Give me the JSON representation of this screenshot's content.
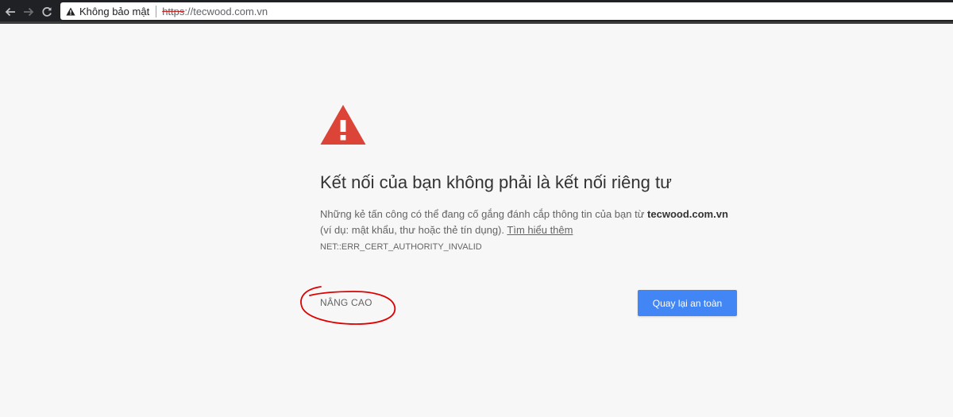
{
  "browser": {
    "security_label": "Không bảo mật",
    "url_scheme": "https",
    "url_rest": "://tecwood.com.vn",
    "icons": {
      "back": "back-arrow-icon",
      "forward": "forward-arrow-icon",
      "reload": "reload-icon",
      "security": "warning-triangle-icon"
    }
  },
  "interstitial": {
    "heading": "Kết nối của bạn không phải là kết nối riêng tư",
    "body_before_domain": "Những kẻ tấn công có thể đang cố gắng đánh cắp thông tin của bạn từ ",
    "domain": "tecwood.com.vn",
    "body_after_domain": " (ví dụ: mật khẩu, thư hoặc thẻ tín dụng). ",
    "learn_more": "Tìm hiểu thêm",
    "error_code": "NET::ERR_CERT_AUTHORITY_INVALID",
    "advanced_label": "NÂNG CAO",
    "back_to_safety_label": "Quay lại an toàn",
    "icon": "warning-triangle-icon"
  },
  "colors": {
    "warning_red": "#db4437",
    "primary_button": "#4285f4",
    "annotation_circle": "#e00000"
  }
}
